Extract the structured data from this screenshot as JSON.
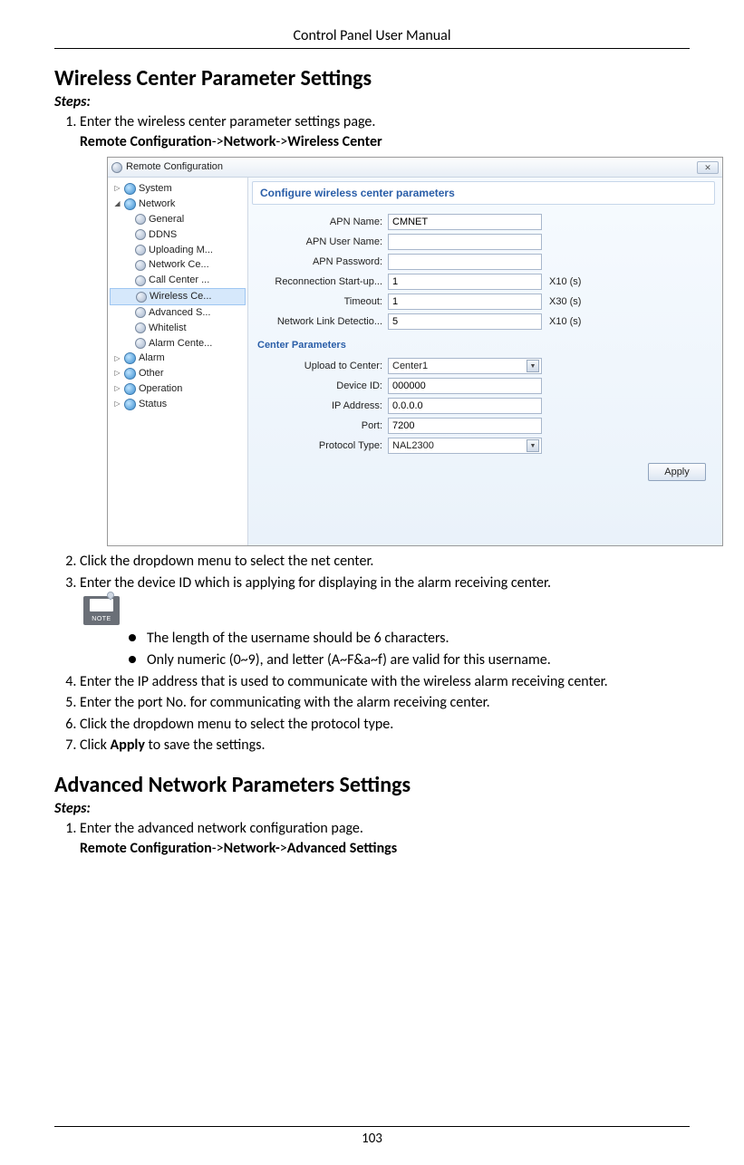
{
  "header": {
    "title": "Control Panel User Manual"
  },
  "section1": {
    "title": "Wireless Center Parameter Settings",
    "steps_label": "Steps:",
    "step1_a": "Enter the wireless center parameter settings page.",
    "step1_b_prefix": "Remote Configuration",
    "step1_b_sep1": "->",
    "step1_b_mid": "Network",
    "step1_b_sep2": "->",
    "step1_b_end": "Wireless Center",
    "step2": "Click the dropdown menu to select the net center.",
    "step3": "Enter the device ID which is applying for displaying in the alarm receiving center.",
    "note_bullet1": "The length of the username should be 6 characters.",
    "note_bullet2": "Only numeric (0~9), and letter (A~F&a~f) are valid for this username.",
    "step4": "Enter the IP address that is used to communicate with the wireless alarm receiving center.",
    "step5": "Enter the port No. for communicating with the alarm receiving center.",
    "step6": "Click the dropdown menu to select the protocol type.",
    "step7_a": "Click ",
    "step7_b": "Apply",
    "step7_c": " to save the settings."
  },
  "section2": {
    "title": "Advanced Network Parameters Settings",
    "steps_label": "Steps:",
    "step1_a": "Enter the advanced network configuration page.",
    "step1_b_prefix": "Remote Configuration",
    "step1_b_sep1": "->",
    "step1_b_mid": "Network-",
    "step1_b_sep2": ">",
    "step1_b_end": "Advanced Settings"
  },
  "screenshot": {
    "window_title": "Remote Configuration",
    "close_glyph": "✕",
    "tree": {
      "top": [
        "System",
        "Network"
      ],
      "network_children": [
        "General",
        "DDNS",
        "Uploading M...",
        "Network Ce...",
        "Call Center ...",
        "Wireless Ce...",
        "Advanced S...",
        "Whitelist",
        "Alarm Cente..."
      ],
      "after": [
        "Alarm",
        "Other",
        "Operation",
        "Status"
      ]
    },
    "banner": "Configure wireless center parameters",
    "fields": {
      "apn_name": {
        "label": "APN Name:",
        "value": "CMNET"
      },
      "apn_user": {
        "label": "APN User Name:",
        "value": ""
      },
      "apn_pass": {
        "label": "APN Password:",
        "value": ""
      },
      "reconn": {
        "label": "Reconnection Start-up...",
        "value": "1",
        "suffix": "X10 (s)"
      },
      "timeout": {
        "label": "Timeout:",
        "value": "1",
        "suffix": "X30 (s)"
      },
      "netlink": {
        "label": "Network Link Detectio...",
        "value": "5",
        "suffix": "X10 (s)"
      }
    },
    "center_params_label": "Center Parameters",
    "center_fields": {
      "upload": {
        "label": "Upload to Center:",
        "value": "Center1"
      },
      "device_id": {
        "label": "Device ID:",
        "value": "000000"
      },
      "ip": {
        "label": "IP Address:",
        "value": "0.0.0.0"
      },
      "port": {
        "label": "Port:",
        "value": "7200"
      },
      "protocol": {
        "label": "Protocol Type:",
        "value": "NAL2300"
      }
    },
    "apply_button": "Apply"
  },
  "page_number": "103"
}
